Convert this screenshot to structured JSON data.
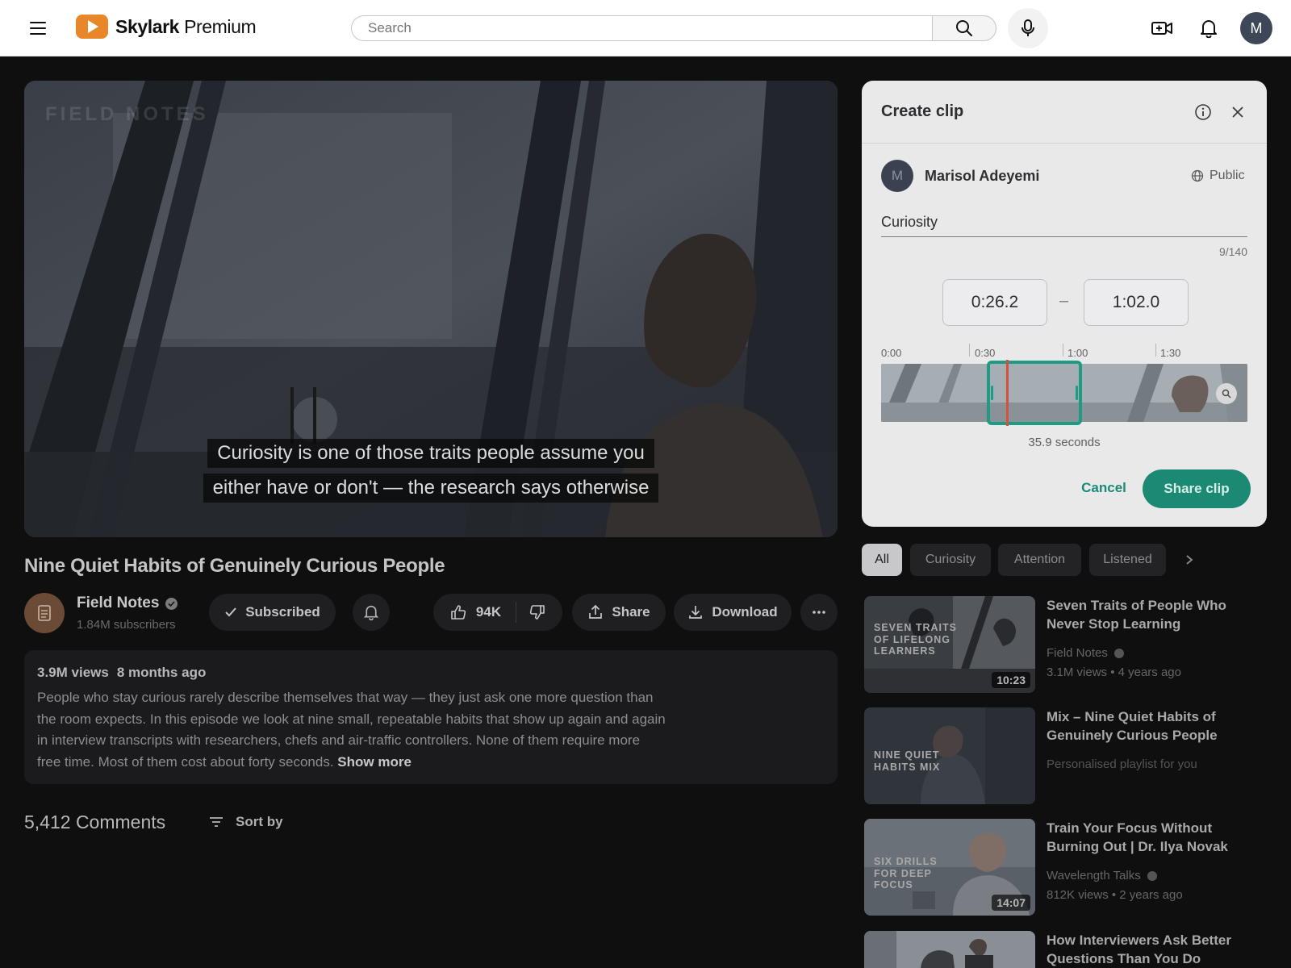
{
  "header": {
    "brand_name": "Skylark",
    "brand_tier": "Premium",
    "search_placeholder": "Search",
    "avatar_initial": "M",
    "brand_color": "#e8862a"
  },
  "player": {
    "watermark": "FIELD NOTES",
    "caption_lines": [
      "Curiosity is one of those traits people assume you",
      "either have or don't — the research says otherwise"
    ]
  },
  "video": {
    "title": "Nine Quiet Habits of Genuinely Curious People",
    "channel": "Field Notes",
    "subscribers": "1.84M subscribers",
    "subscribe_label": "Subscribed",
    "likes": "94K",
    "share_label": "Share",
    "download_label": "Download",
    "views": "3.9M views",
    "age": "8 months ago",
    "description": "People who stay curious rarely describe themselves that way — they just ask one more question than the room expects. In this episode we look at nine small, repeatable habits that show up again and again in interview transcripts with researchers, chefs and air-traffic controllers. None of them require more free time. Most of them cost about forty seconds.",
    "show_more": "Show more",
    "comments_count": "5,412 Comments",
    "sort_label": "Sort by"
  },
  "clip": {
    "title": "Create clip",
    "user_initial": "M",
    "user_name": "Marisol Adeyemi",
    "visibility": "Public",
    "clip_title_value": "Curiosity",
    "char_counter": "9/140",
    "start_time": "0:26.2",
    "end_time": "1:02.0",
    "dash": "–",
    "ticks": [
      "0:00",
      "0:30",
      "1:00",
      "1:30"
    ],
    "duration_label": "35.9 seconds",
    "cancel_label": "Cancel",
    "share_label": "Share clip",
    "accent_color": "#1b8973"
  },
  "chips": [
    "All",
    "Curiosity",
    "Attention",
    "Listened"
  ],
  "recommendations": [
    {
      "thumb_text": "Seven traits of lifelong learners",
      "duration": "10:23",
      "title": "Seven Traits of People Who Never Stop Learning",
      "channel": "Field Notes",
      "stats": "3.1M views • 4 years ago"
    },
    {
      "thumb_text": "Nine quiet habits mix",
      "title": "Mix – Nine Quiet Habits of Genuinely Curious People",
      "subtitle": "Personalised playlist for you"
    },
    {
      "thumb_text": "Six drills for deep focus",
      "duration": "14:07",
      "title": "Train Your Focus Without Burning Out | Dr. Ilya Novak",
      "channel": "Wavelength Talks",
      "stats": "812K views • 2 years ago"
    },
    {
      "title": "How Interviewers Ask Better Questions Than You Do"
    }
  ]
}
